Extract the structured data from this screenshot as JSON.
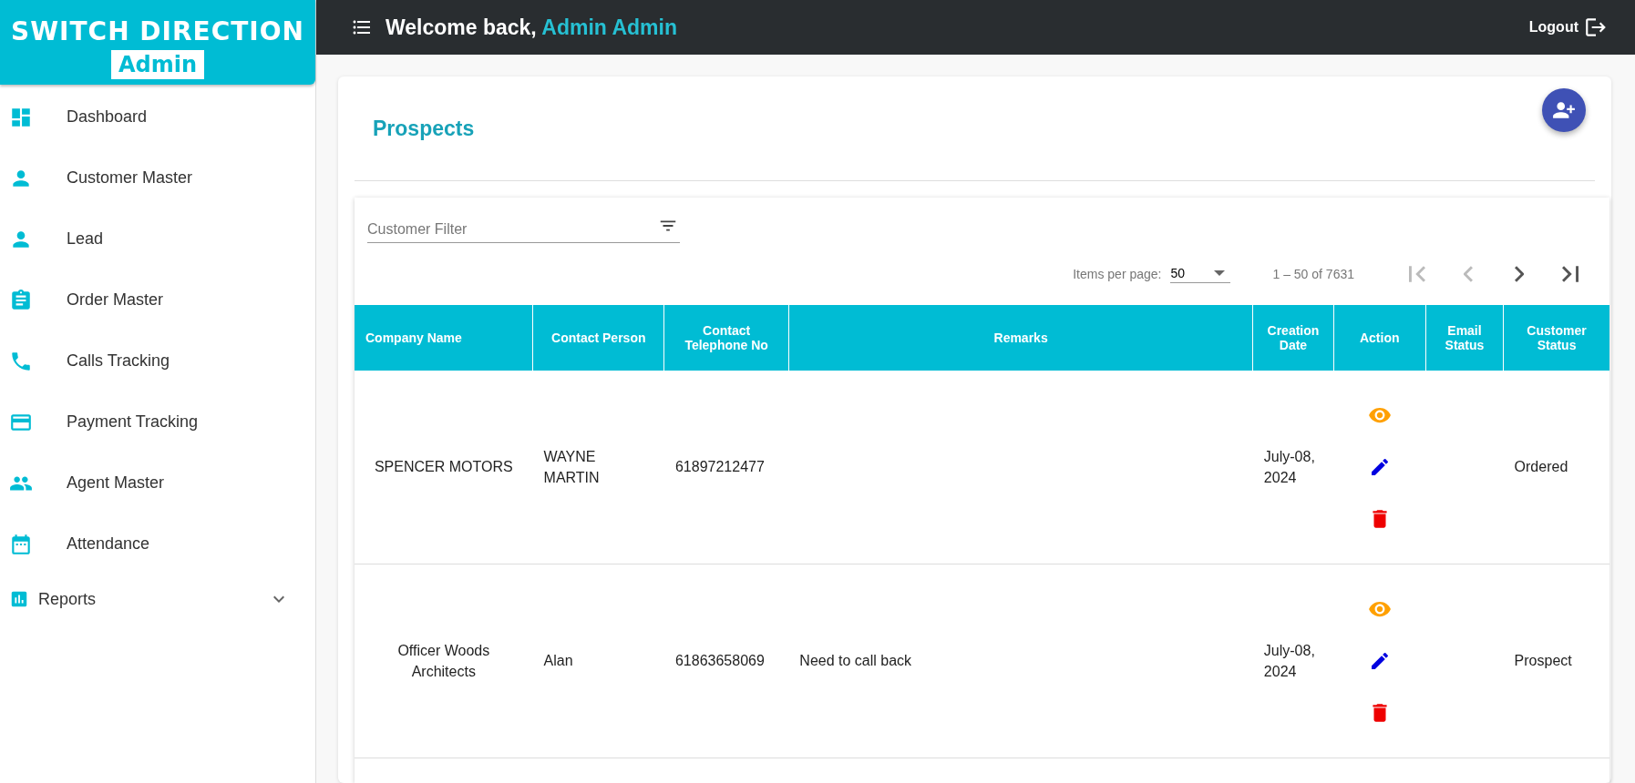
{
  "logo": {
    "title": "SWITCH DIRECTION",
    "subtitle": "Admin"
  },
  "sidebar": {
    "items": [
      {
        "label": "Dashboard",
        "kind": "link"
      },
      {
        "label": "Customer Master",
        "kind": "link"
      },
      {
        "label": "Lead",
        "kind": "link"
      },
      {
        "label": "Order Master",
        "kind": "link"
      },
      {
        "label": "Calls Tracking",
        "kind": "link"
      },
      {
        "label": "Payment Tracking",
        "kind": "link"
      },
      {
        "label": "Agent Master",
        "kind": "link"
      },
      {
        "label": "Attendance",
        "kind": "link"
      },
      {
        "label": "Reports",
        "kind": "group",
        "expanded": false
      }
    ]
  },
  "header": {
    "greeting": "Welcome back,",
    "user": "Admin Admin",
    "logout": "Logout"
  },
  "page": {
    "title": "Prospects"
  },
  "filter": {
    "placeholder": "Customer Filter"
  },
  "paginator": {
    "label": "Items per page:",
    "page_size": "50",
    "range": "1 – 50 of 7631",
    "first_disabled": true,
    "prev_disabled": true,
    "next_disabled": false,
    "last_disabled": false
  },
  "table": {
    "columns": [
      "Company Name",
      "Contact Person",
      "Contact Telephone No",
      "Remarks",
      "Creation Date",
      "Action",
      "Email Status",
      "Customer Status"
    ],
    "rows": [
      {
        "company": "SPENCER MOTORS",
        "contact": "WAYNE MARTIN",
        "phone": "61897212477",
        "date": "July-08, 2024",
        "customer_status": "Ordered"
      },
      {
        "company": "Officer Woods Architects",
        "contact": "Alan",
        "phone": "61863658069",
        "remarks": "Need to call back",
        "date": "July-08, 2024",
        "customer_status": "Prospect"
      }
    ]
  }
}
